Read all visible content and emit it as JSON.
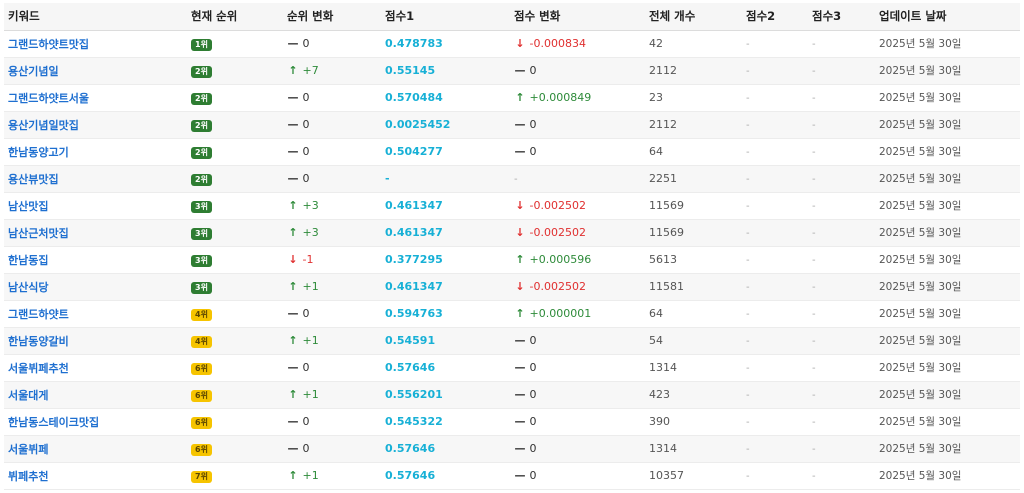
{
  "headers": {
    "keyword": "키워드",
    "rank": "현재 순위",
    "rank_change": "순위 변화",
    "score1": "점수1",
    "score_change": "점수 변화",
    "total": "전체 개수",
    "score2": "점수2",
    "score3": "점수3",
    "updated": "업데이트 날짜"
  },
  "colors": {
    "up": "#2e8b3a",
    "down": "#e03030",
    "link": "#1e6fd0",
    "score": "#17b0d6",
    "badge_green": "#2e7d32",
    "badge_yellow": "#f6c400"
  },
  "rows": [
    {
      "keyword": "그랜드하얏트맛집",
      "rank": "1위",
      "badge": "green",
      "rank_change": {
        "dir": "none",
        "value": "0"
      },
      "score1": "0.478783",
      "score_change": {
        "dir": "down",
        "value": "-0.000834"
      },
      "total": "42",
      "score2": "-",
      "score3": "-",
      "updated": "2025년 5월 30일"
    },
    {
      "keyword": "용산기념일",
      "rank": "2위",
      "badge": "green",
      "rank_change": {
        "dir": "up",
        "value": "+7"
      },
      "score1": "0.55145",
      "score_change": {
        "dir": "none",
        "value": "0"
      },
      "total": "2112",
      "score2": "-",
      "score3": "-",
      "updated": "2025년 5월 30일"
    },
    {
      "keyword": "그랜드하얏트서울",
      "rank": "2위",
      "badge": "green",
      "rank_change": {
        "dir": "none",
        "value": "0"
      },
      "score1": "0.570484",
      "score_change": {
        "dir": "up",
        "value": "+0.000849"
      },
      "total": "23",
      "score2": "-",
      "score3": "-",
      "updated": "2025년 5월 30일"
    },
    {
      "keyword": "용산기념일맛집",
      "rank": "2위",
      "badge": "green",
      "rank_change": {
        "dir": "none",
        "value": "0"
      },
      "score1": "0.0025452",
      "score_change": {
        "dir": "none",
        "value": "0"
      },
      "total": "2112",
      "score2": "-",
      "score3": "-",
      "updated": "2025년 5월 30일"
    },
    {
      "keyword": "한남동양고기",
      "rank": "2위",
      "badge": "green",
      "rank_change": {
        "dir": "none",
        "value": "0"
      },
      "score1": "0.504277",
      "score_change": {
        "dir": "none",
        "value": "0"
      },
      "total": "64",
      "score2": "-",
      "score3": "-",
      "updated": "2025년 5월 30일"
    },
    {
      "keyword": "용산뷰맛집",
      "rank": "2위",
      "badge": "green",
      "rank_change": {
        "dir": "none",
        "value": "0"
      },
      "score1": "-",
      "score_change": {
        "dir": "blank",
        "value": "-"
      },
      "total": "2251",
      "score2": "-",
      "score3": "-",
      "updated": "2025년 5월 30일"
    },
    {
      "keyword": "남산맛집",
      "rank": "3위",
      "badge": "green",
      "rank_change": {
        "dir": "up",
        "value": "+3"
      },
      "score1": "0.461347",
      "score_change": {
        "dir": "down",
        "value": "-0.002502"
      },
      "total": "11569",
      "score2": "-",
      "score3": "-",
      "updated": "2025년 5월 30일"
    },
    {
      "keyword": "남산근처맛집",
      "rank": "3위",
      "badge": "green",
      "rank_change": {
        "dir": "up",
        "value": "+3"
      },
      "score1": "0.461347",
      "score_change": {
        "dir": "down",
        "value": "-0.002502"
      },
      "total": "11569",
      "score2": "-",
      "score3": "-",
      "updated": "2025년 5월 30일"
    },
    {
      "keyword": "한남동집",
      "rank": "3위",
      "badge": "green",
      "rank_change": {
        "dir": "down",
        "value": "-1"
      },
      "score1": "0.377295",
      "score_change": {
        "dir": "up",
        "value": "+0.000596"
      },
      "total": "5613",
      "score2": "-",
      "score3": "-",
      "updated": "2025년 5월 30일"
    },
    {
      "keyword": "남산식당",
      "rank": "3위",
      "badge": "green",
      "rank_change": {
        "dir": "up",
        "value": "+1"
      },
      "score1": "0.461347",
      "score_change": {
        "dir": "down",
        "value": "-0.002502"
      },
      "total": "11581",
      "score2": "-",
      "score3": "-",
      "updated": "2025년 5월 30일"
    },
    {
      "keyword": "그랜드하얏트",
      "rank": "4위",
      "badge": "yellow",
      "rank_change": {
        "dir": "none",
        "value": "0"
      },
      "score1": "0.594763",
      "score_change": {
        "dir": "up",
        "value": "+0.000001"
      },
      "total": "64",
      "score2": "-",
      "score3": "-",
      "updated": "2025년 5월 30일"
    },
    {
      "keyword": "한남동양갈비",
      "rank": "4위",
      "badge": "yellow",
      "rank_change": {
        "dir": "up",
        "value": "+1"
      },
      "score1": "0.54591",
      "score_change": {
        "dir": "none",
        "value": "0"
      },
      "total": "54",
      "score2": "-",
      "score3": "-",
      "updated": "2025년 5월 30일"
    },
    {
      "keyword": "서울뷔페추천",
      "rank": "6위",
      "badge": "yellow",
      "rank_change": {
        "dir": "none",
        "value": "0"
      },
      "score1": "0.57646",
      "score_change": {
        "dir": "none",
        "value": "0"
      },
      "total": "1314",
      "score2": "-",
      "score3": "-",
      "updated": "2025년 5월 30일"
    },
    {
      "keyword": "서울대게",
      "rank": "6위",
      "badge": "yellow",
      "rank_change": {
        "dir": "up",
        "value": "+1"
      },
      "score1": "0.556201",
      "score_change": {
        "dir": "none",
        "value": "0"
      },
      "total": "423",
      "score2": "-",
      "score3": "-",
      "updated": "2025년 5월 30일"
    },
    {
      "keyword": "한남동스테이크맛집",
      "rank": "6위",
      "badge": "yellow",
      "rank_change": {
        "dir": "none",
        "value": "0"
      },
      "score1": "0.545322",
      "score_change": {
        "dir": "none",
        "value": "0"
      },
      "total": "390",
      "score2": "-",
      "score3": "-",
      "updated": "2025년 5월 30일"
    },
    {
      "keyword": "서울뷔페",
      "rank": "6위",
      "badge": "yellow",
      "rank_change": {
        "dir": "none",
        "value": "0"
      },
      "score1": "0.57646",
      "score_change": {
        "dir": "none",
        "value": "0"
      },
      "total": "1314",
      "score2": "-",
      "score3": "-",
      "updated": "2025년 5월 30일"
    },
    {
      "keyword": "뷔페추천",
      "rank": "7위",
      "badge": "yellow",
      "rank_change": {
        "dir": "up",
        "value": "+1"
      },
      "score1": "0.57646",
      "score_change": {
        "dir": "none",
        "value": "0"
      },
      "total": "10357",
      "score2": "-",
      "score3": "-",
      "updated": "2025년 5월 30일"
    }
  ]
}
